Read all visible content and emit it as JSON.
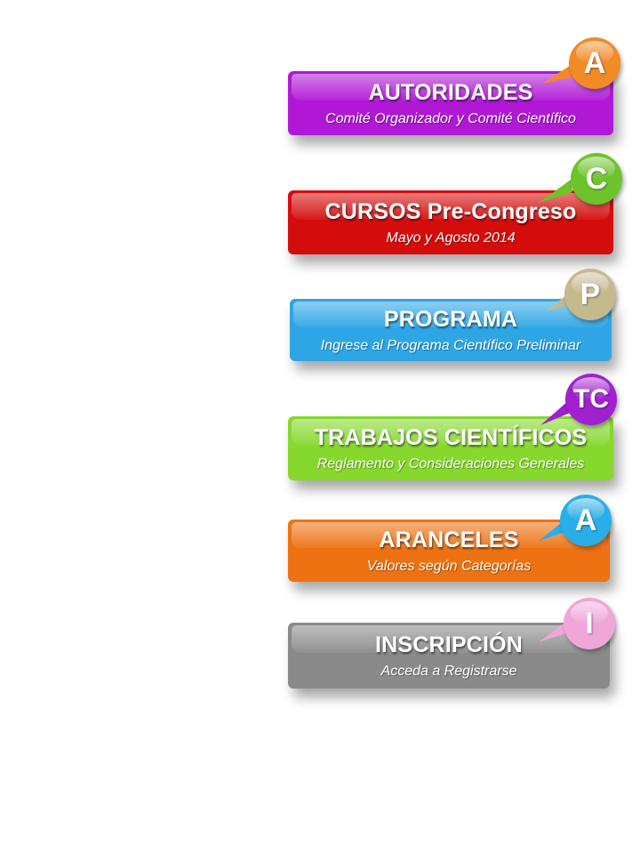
{
  "menu": [
    {
      "title": "AUTORIDADES",
      "subtitle": "Comité Organizador  y Comité Científico",
      "color": "#b018d6",
      "letter": "A",
      "bubble_color": "#f28a26"
    },
    {
      "title": "CURSOS Pre-Congreso",
      "subtitle": "Mayo y Agosto  2014",
      "color": "#d50c0c",
      "letter": "C",
      "bubble_color": "#6cc42a"
    },
    {
      "title": "PROGRAMA",
      "subtitle": "Ingrese al Programa Científico  Preliminar",
      "color": "#2ea6e6",
      "letter": "P",
      "bubble_color": "#c5b98e"
    },
    {
      "title": "TRABAJOS CIENTÍFICOS",
      "subtitle": "Reglamento y Consideraciones Generales",
      "color": "#86d82c",
      "letter": "TC",
      "bubble_color": "#a120cf"
    },
    {
      "title": "ARANCELES",
      "subtitle": "Valores según Categorías",
      "color": "#ee7212",
      "letter": "A",
      "bubble_color": "#2aaee8"
    },
    {
      "title": "INSCRIPCIÓN",
      "subtitle": "Acceda a Registrarse",
      "color": "#8a8a8a",
      "letter": "I",
      "bubble_color": "#f0a6d8"
    }
  ]
}
